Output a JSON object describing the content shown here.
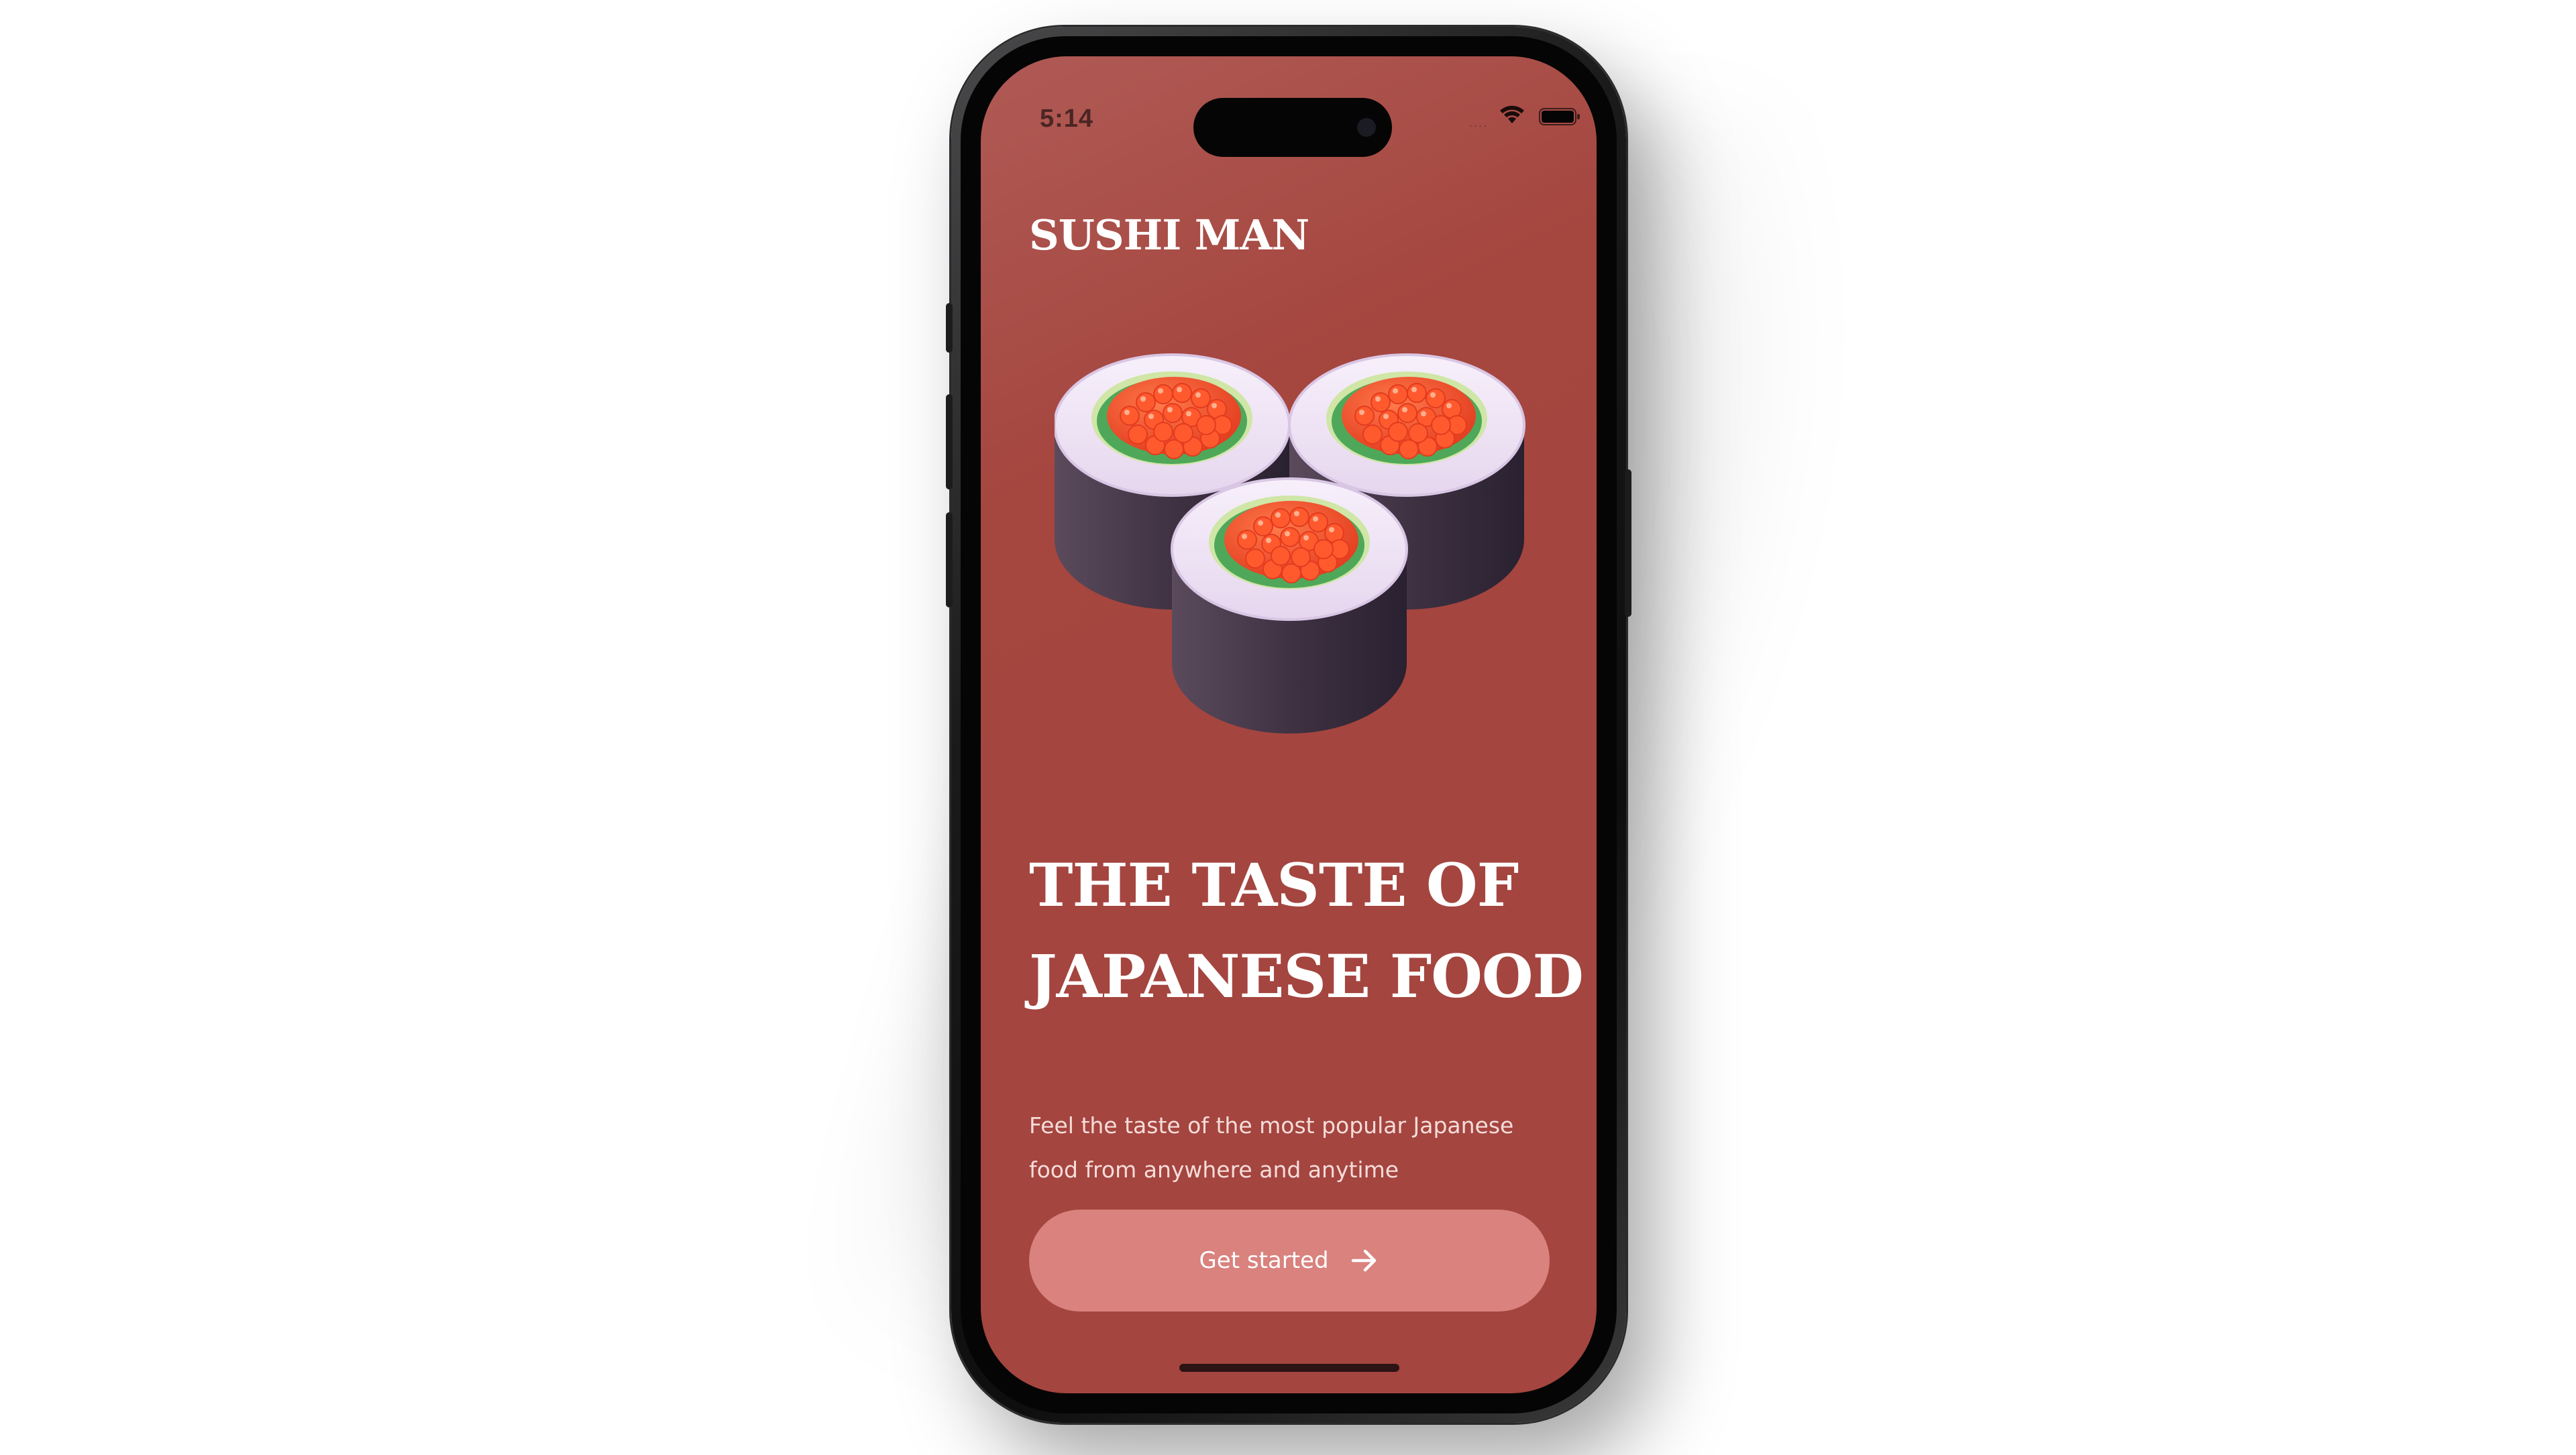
{
  "status_bar": {
    "time": "5:14",
    "signal_dots": "....",
    "wifi_icon": "wifi-icon",
    "battery_icon": "battery-icon"
  },
  "app": {
    "brand": "SUSHI MAN",
    "hero_icon": "sushi-rolls-illustration",
    "headline_line1": "THE TASTE OF",
    "headline_line2": "JAPANESE FOOD",
    "subtitle_line1": "Feel the taste of the most popular Japanese",
    "subtitle_line2": "food from anywhere and anytime",
    "cta_label": "Get started",
    "cta_icon": "arrow-right-icon"
  },
  "colors": {
    "background": "#a4453f",
    "button": "#d9827e",
    "text": "#ffffff"
  }
}
